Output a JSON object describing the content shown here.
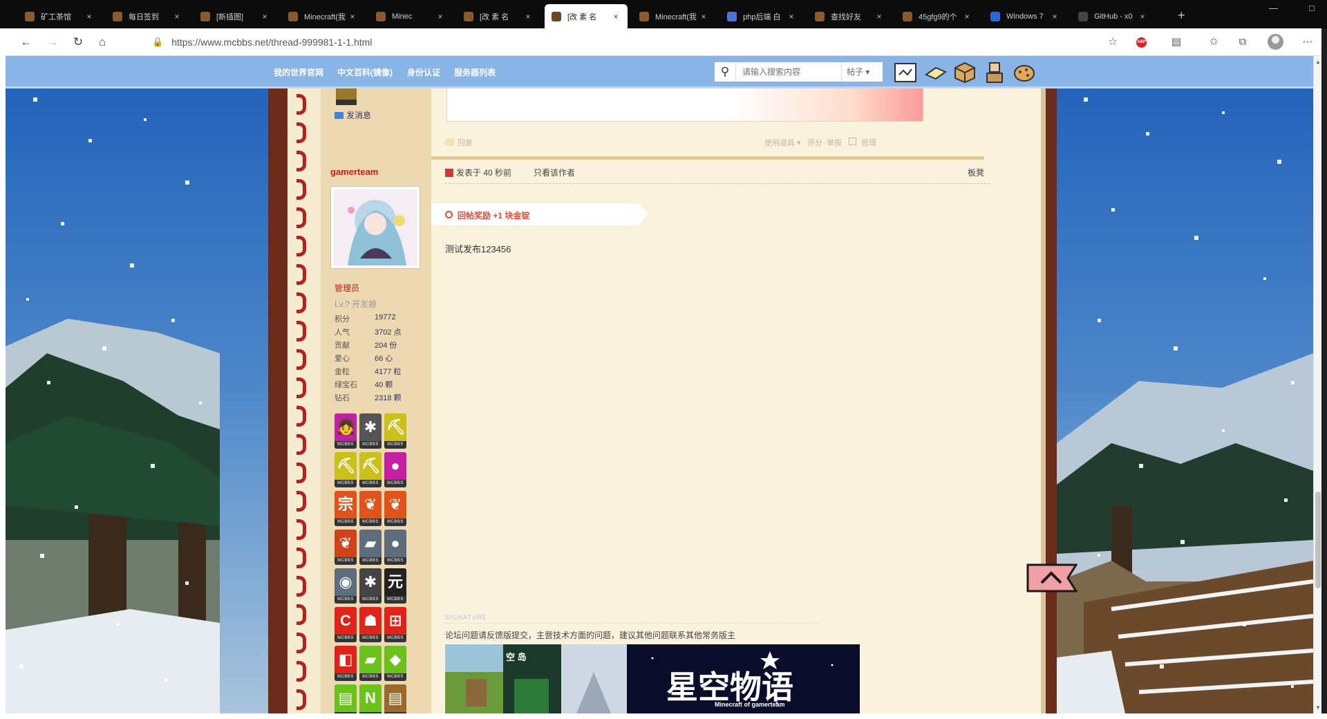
{
  "browser": {
    "tabs": [
      {
        "title": "矿工茶馆",
        "close": "×",
        "color": "#8a5a2c"
      },
      {
        "title": "每日签到",
        "close": "×",
        "color": "#8a5a2c"
      },
      {
        "title": "[新插图]",
        "close": "×",
        "color": "#8a5a2c"
      },
      {
        "title": "Minecraft(我",
        "close": "×",
        "color": "#8a5a2c"
      },
      {
        "title": "Minec",
        "close": "×",
        "color": "#8a5a2c"
      },
      {
        "title": "[改 素 名",
        "close": "×",
        "color": "#8a5a2c"
      },
      {
        "title": "[改 素 名",
        "close": "×",
        "color": "#6b4a22",
        "active": true
      },
      {
        "title": "Minecraft(我",
        "close": "×",
        "color": "#8a5a2c"
      },
      {
        "title": "php后端 白",
        "close": "×",
        "color": "#4a74d9"
      },
      {
        "title": "查找好友",
        "close": "×",
        "color": "#8a5a2c"
      },
      {
        "title": "45gfg9的个",
        "close": "×",
        "color": "#8a5a2c"
      },
      {
        "title": "Windows 7",
        "close": "×",
        "color": "#2a6ad8"
      },
      {
        "title": "GitHub - x0",
        "close": "×",
        "color": "#444444"
      }
    ],
    "new_tab": "+",
    "url": "https://www.mcbbs.net/thread-999981-1-1.html",
    "abp_label": "ABP",
    "window_controls": [
      "—",
      "□"
    ]
  },
  "forum": {
    "nav_links": [
      "我的世界官网",
      "中文百科(镜像)",
      "身份认证",
      "服务器列表"
    ],
    "search_placeholder": "请输入搜索内容",
    "search_type": "帖子 ▾",
    "accent": "#89b4e8"
  },
  "post": {
    "send_message": "发消息",
    "author": "gamerteam",
    "group": "管理员",
    "level": "Lv.? 开发姬",
    "stats": [
      {
        "k": "积分",
        "v": "19772"
      },
      {
        "k": "人气",
        "v": "3702 点"
      },
      {
        "k": "贡献",
        "v": "204 份"
      },
      {
        "k": "爱心",
        "v": "66 心"
      },
      {
        "k": "金粒",
        "v": "4177 粒"
      },
      {
        "k": "绿宝石",
        "v": "40 颗"
      },
      {
        "k": "钻石",
        "v": "2318 颗"
      }
    ],
    "reply_label": "回复",
    "tools": [
      "使用道具 ▾",
      "评分",
      "举报",
      "管理"
    ],
    "posted_time": "发表于 40 秒前",
    "only_author": "只看该作者",
    "floor_label": "板凳",
    "reward_text": "回帖奖励 +1 块金锭",
    "content": "测试发布123456",
    "signature_tag": "SIGNATURE",
    "signature_text": "论坛问题请反馈版提交，主营技术方面的问题，建议其他问题联系其他常务版主",
    "sig_left_label": "空 岛",
    "sig_banner_title": "星空物语",
    "sig_banner_sub": "Minecraft of gamerteam",
    "medals": [
      {
        "c": "#c51fa4",
        "g": "👧"
      },
      {
        "c": "#555555",
        "g": "✱"
      },
      {
        "c": "#c9c01a",
        "g": "⛏"
      },
      {
        "c": "#c9c01a",
        "g": "⛏"
      },
      {
        "c": "#c9c01a",
        "g": "⛏"
      },
      {
        "c": "#c51fa4",
        "g": "●"
      },
      {
        "c": "#e0531a",
        "g": "宗"
      },
      {
        "c": "#e0531a",
        "g": "❦"
      },
      {
        "c": "#e0531a",
        "g": "❦"
      },
      {
        "c": "#d0431a",
        "g": "❦"
      },
      {
        "c": "#5d6d7d",
        "g": "▰"
      },
      {
        "c": "#5d6d7d",
        "g": "●"
      },
      {
        "c": "#5d6d7d",
        "g": "◉"
      },
      {
        "c": "#444444",
        "g": "✱"
      },
      {
        "c": "#222222",
        "g": "元"
      },
      {
        "c": "#e0231a",
        "g": "C"
      },
      {
        "c": "#e0231a",
        "g": "☗"
      },
      {
        "c": "#e0231a",
        "g": "⊞"
      },
      {
        "c": "#e0231a",
        "g": "◧"
      },
      {
        "c": "#6ac21a",
        "g": "▰"
      },
      {
        "c": "#6ac21a",
        "g": "◆"
      },
      {
        "c": "#6ac21a",
        "g": "▤"
      },
      {
        "c": "#6ac21a",
        "g": "N"
      },
      {
        "c": "#9a6a2a",
        "g": "▤"
      }
    ],
    "medal_label": "MCBBS"
  }
}
